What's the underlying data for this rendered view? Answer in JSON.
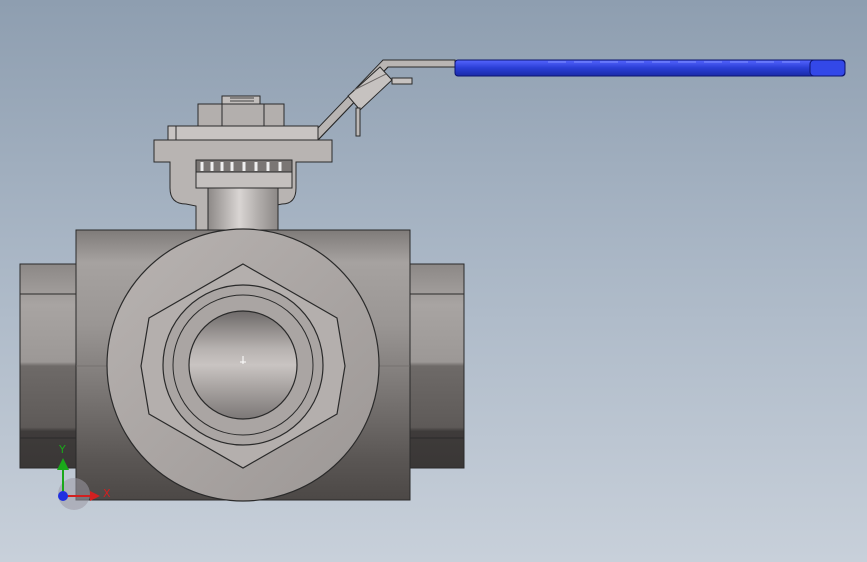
{
  "triad": {
    "y_label": "Y",
    "x_label": "X"
  },
  "colors": {
    "handle": "#2a3ed6",
    "background_top": "#8e9eb0",
    "background_bottom": "#c8d0da",
    "body_metal": "#8b8784",
    "axis_x": "#d22020",
    "axis_y": "#1aa81a",
    "axis_z": "#2030e0"
  }
}
